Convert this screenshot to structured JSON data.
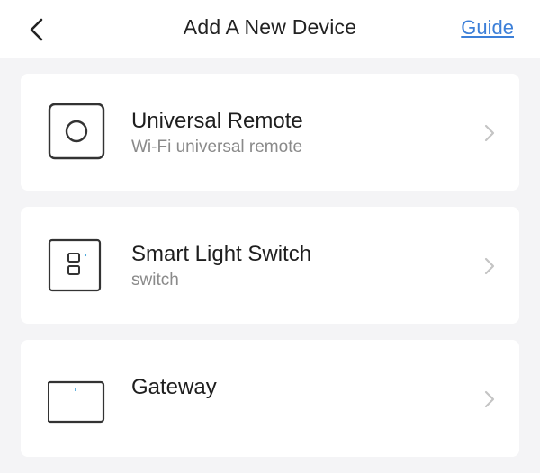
{
  "header": {
    "back_icon": "chevron-left-icon",
    "title": "Add A New Device",
    "guide_label": "Guide",
    "guide_color": "#3c7fd8"
  },
  "devices": [
    {
      "title": "Universal Remote",
      "subtitle": "Wi-Fi universal remote",
      "icon": "universal-remote-icon"
    },
    {
      "title": "Smart Light Switch",
      "subtitle": "switch",
      "icon": "light-switch-icon"
    },
    {
      "title": "Gateway",
      "subtitle": "",
      "icon": "gateway-icon"
    }
  ],
  "colors": {
    "background": "#f4f4f6",
    "card": "#ffffff",
    "title_text": "#1e1e1e",
    "subtitle_text": "#8a8a8a",
    "chevron": "#c4c4c4"
  }
}
